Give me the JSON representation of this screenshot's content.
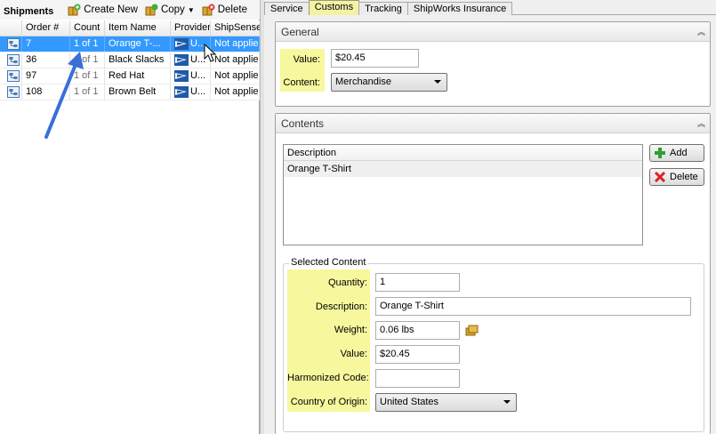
{
  "left": {
    "title": "Shipments",
    "toolbar": {
      "create_new": "Create New",
      "copy": "Copy",
      "delete": "Delete"
    },
    "columns": [
      "Order #",
      "Count",
      "Item Name",
      "Provider",
      "ShipSense"
    ],
    "rows": [
      {
        "order": "7",
        "count": "1 of 1",
        "item": "Orange T-...",
        "provider": "U...",
        "shipsense": "Not applie"
      },
      {
        "order": "36",
        "count": "1 of 1",
        "item": "Black Slacks",
        "provider": "U...",
        "shipsense": "Not applie"
      },
      {
        "order": "97",
        "count": "1 of 1",
        "item": "Red Hat",
        "provider": "U...",
        "shipsense": "Not applie"
      },
      {
        "order": "108",
        "count": "1 of 1",
        "item": "Brown Belt",
        "provider": "U...",
        "shipsense": "Not applie"
      }
    ]
  },
  "tabs": [
    "Service",
    "Customs",
    "Tracking",
    "ShipWorks Insurance"
  ],
  "general": {
    "title": "General",
    "value_label": "Value:",
    "value": "$20.45",
    "content_label": "Content:",
    "content": "Merchandise"
  },
  "contents": {
    "title": "Contents",
    "list_header": "Description",
    "items": [
      "Orange T-Shirt"
    ],
    "add_label": "Add",
    "delete_label": "Delete",
    "selected": {
      "title": "Selected Content",
      "quantity_label": "Quantity:",
      "quantity": "1",
      "description_label": "Description:",
      "description": "Orange T-Shirt",
      "weight_label": "Weight:",
      "weight": "0.06 lbs",
      "value_label": "Value:",
      "value": "$20.45",
      "harmonized_label": "Harmonized Code:",
      "harmonized": "",
      "country_label": "Country of Origin:",
      "country": "United States"
    }
  },
  "colors": {
    "selection": "#3399ff",
    "highlight": "#f7f79e",
    "active_tab": "#f3f2a6",
    "arrow": "#3a6fd8"
  }
}
